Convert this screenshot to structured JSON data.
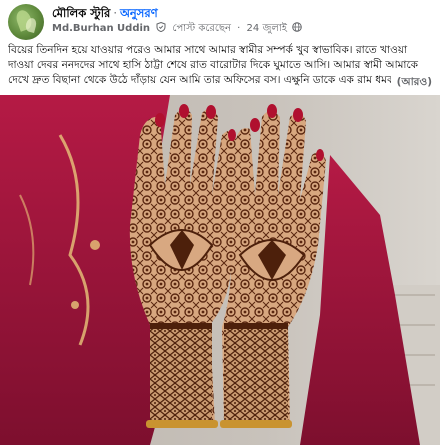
{
  "post": {
    "group_name": "মৌলিক স্টুরি",
    "separator": "·",
    "follow_label": "অনুসরণ",
    "author": "Md.Burhan Uddin",
    "posted_label": "পোস্ট করেছেন",
    "date": "24 জুলাই",
    "text": "বিয়ের তিনদিন হয়ে যাওয়ার পরেও আমার সাথে আমার স্বামীর সম্পর্ক খুব স্বাভাবিক। রাতে খাওয়া দাওয়া দেবর ননদদের সাথে হাসি ঠাট্টা শেষে রাত বারোটার দিকে ঘুমাতে আসি। আমার স্বামী আমাকে দেখে দ্রুত বিছানা থেকে উঠে দাঁড়ায় যেন আমি তার অফিসের বস। এক্ষুনি ডাকে এক রাম ধমক",
    "see_more": "(আরও)",
    "icons": {
      "avatar": "group-avatar-icon",
      "badge": "shield-badge-icon",
      "privacy": "globe-icon"
    },
    "colors": {
      "link": "#0866ff",
      "secondary_text": "#65676b",
      "saree": "#a3143c",
      "henna": "#6a2f14"
    }
  }
}
